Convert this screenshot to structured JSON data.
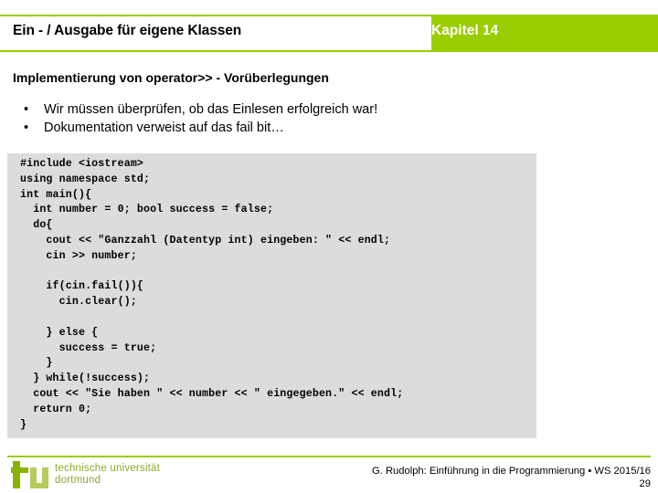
{
  "header": {
    "title": "Ein - / Ausgabe für eigene Klassen",
    "chapter": "Kapitel 14",
    "accent_color": "#9acd00",
    "chapter_text_color": "#ffffff"
  },
  "content": {
    "subtitle": "Implementierung von operator>> - Vorüberlegungen",
    "bullet_glyph": "•",
    "bullets": [
      "Wir müssen überprüfen, ob das Einlesen erfolgreich war!",
      "Dokumentation verweist auf das fail bit…"
    ]
  },
  "code": {
    "background_color": "#dcdcdc",
    "language": "cpp",
    "text": "#include <iostream>\nusing namespace std;\nint main(){\n  int number = 0; bool success = false;\n  do{\n    cout << \"Ganzzahl (Datentyp int) eingeben: \" << endl;\n    cin >> number;\n\n    if(cin.fail()){\n      cin.clear();\n\n    } else {\n      success = true;\n    }\n  } while(!success);\n  cout << \"Sie haben \" << number << \" eingegeben.\" << endl;\n  return 0;\n}"
  },
  "footer": {
    "logo_line1": "technische universität",
    "logo_line2": "dortmund",
    "logo_color": "#8aaa2a",
    "citation": "G. Rudolph: Einführung in die Programmierung ▪ WS 2015/16",
    "page_number": "29"
  }
}
